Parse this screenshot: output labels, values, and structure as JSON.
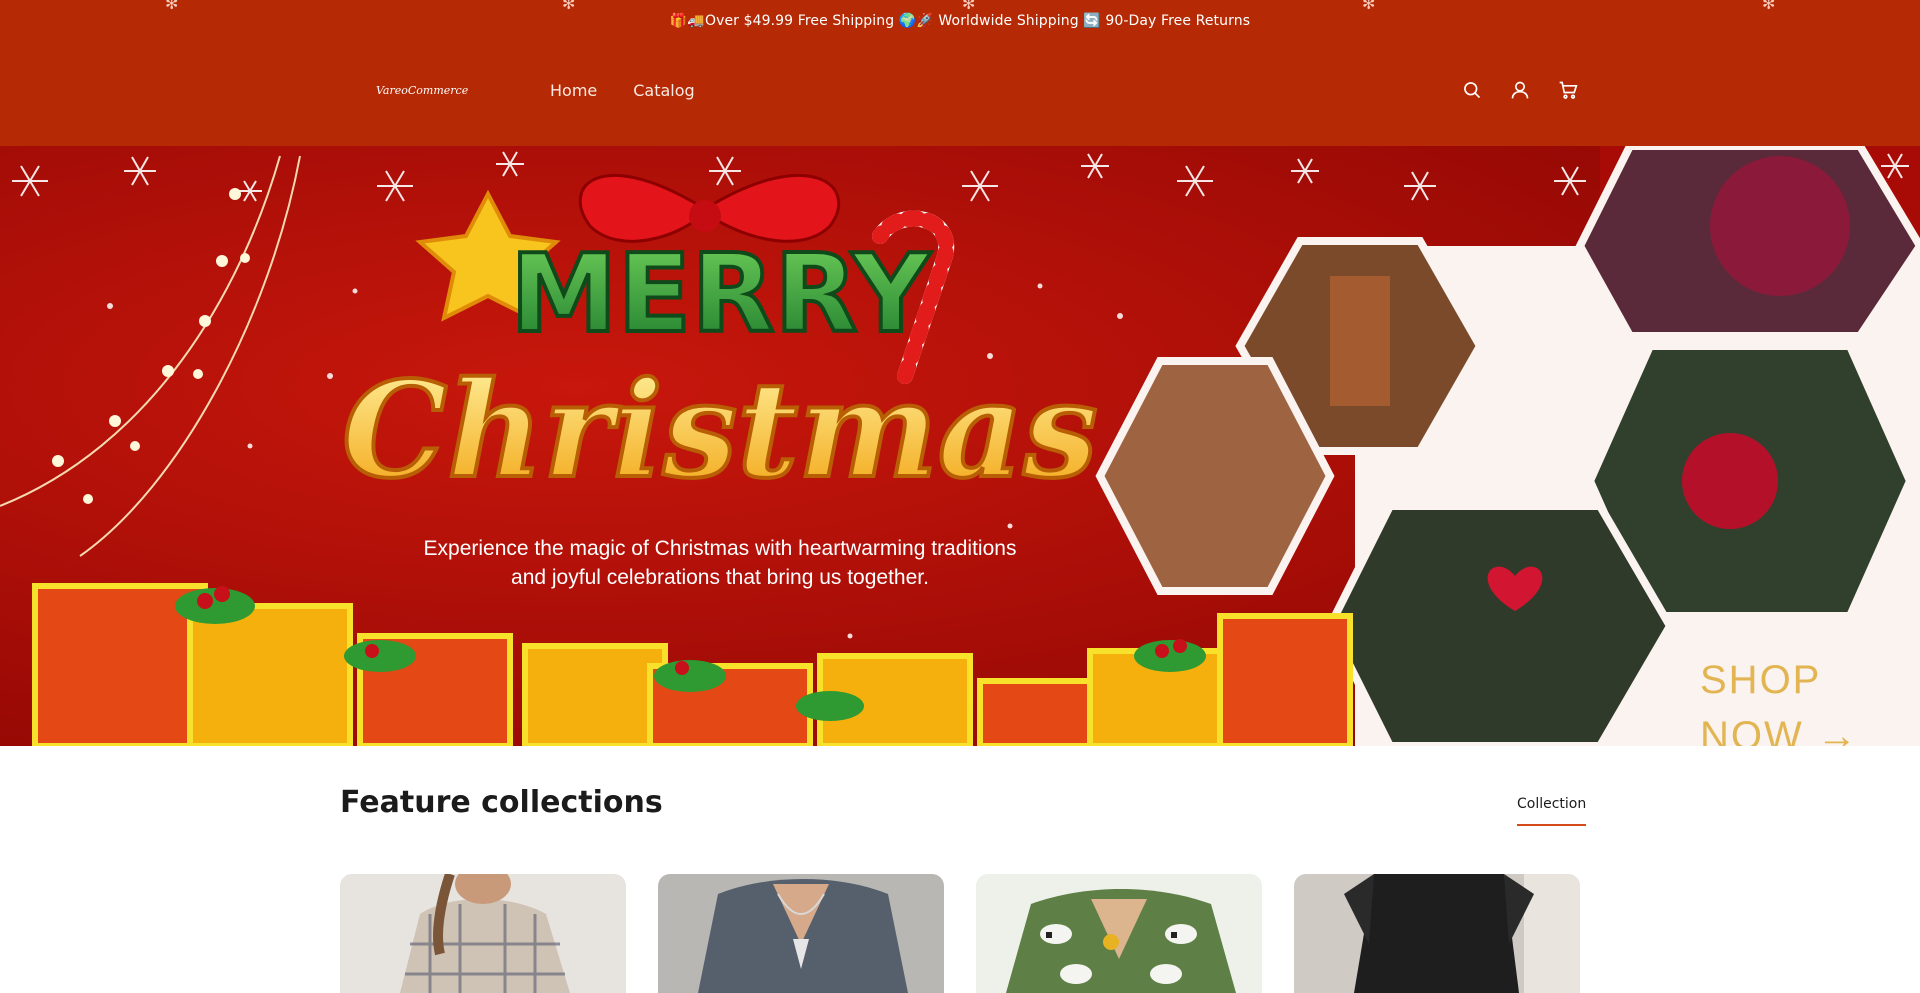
{
  "announcement": {
    "text": "🎁🚚Over $49.99 Free Shipping 🌍🚀 Worldwide Shipping 🔄 90-Day Free Returns"
  },
  "header": {
    "logo": "VareoCommerce",
    "nav": [
      {
        "label": "Home"
      },
      {
        "label": "Catalog"
      }
    ],
    "icons": [
      "search-icon",
      "account-icon",
      "cart-icon"
    ]
  },
  "hero": {
    "image_text": [
      "MERRY",
      "Christmas"
    ],
    "description_line1": "Experience the magic of Christmas with heartwarming traditions",
    "description_line2": "and joyful celebrations that bring us together.",
    "shop_now_line1": "SHOP",
    "shop_now_line2": "NOW →"
  },
  "feature_collections": {
    "title": "Feature collections",
    "link_label": "Collection",
    "cards": [
      {
        "name": "plaid-shirt"
      },
      {
        "name": "grey-v-neck-top"
      },
      {
        "name": "green-sheep-sweater"
      },
      {
        "name": "black-dress"
      }
    ]
  },
  "colors": {
    "brand_red": "#b52a04",
    "hero_red": "#a80b05",
    "accent_underline": "#d64b1b",
    "shop_gold": "#e2b552"
  }
}
